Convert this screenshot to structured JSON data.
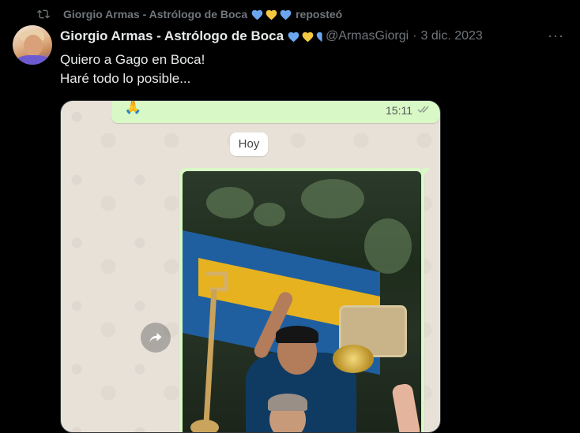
{
  "repost": {
    "author": "Giorgio Armas - Astrólogo de Boca",
    "action": "reposteó"
  },
  "tweet": {
    "display_name": "Giorgio Armas - Astrólogo de Boca",
    "handle": "@ArmasGiorgi",
    "date": "3 dic. 2023",
    "more": "···",
    "text_line1": "Quiero a Gago en Boca!",
    "text_line2": "Haré todo lo posible..."
  },
  "media": {
    "message_time": "15:11",
    "day_label": "Hoy"
  },
  "colors": {
    "heart_blue": "#6ca6ee",
    "heart_yellow": "#f5c842"
  }
}
